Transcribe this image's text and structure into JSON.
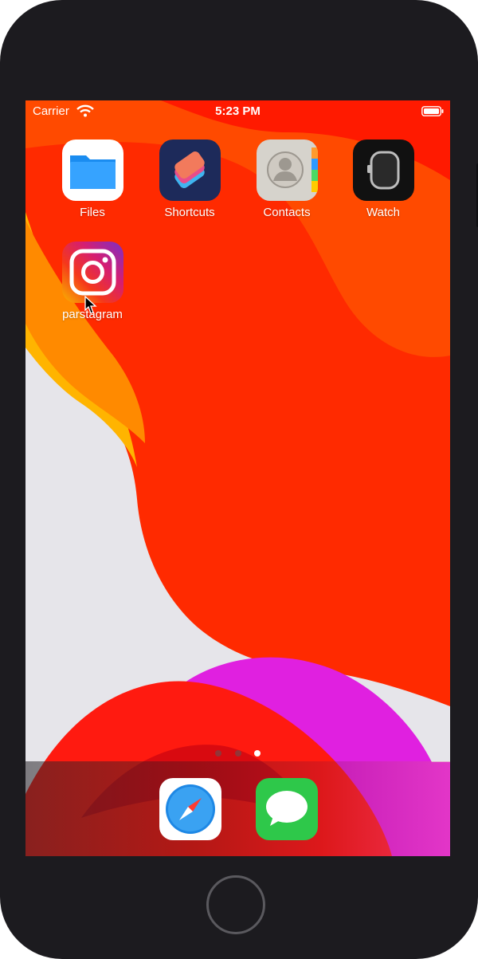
{
  "status_bar": {
    "carrier": "Carrier",
    "time": "5:23 PM"
  },
  "apps": [
    {
      "label": "Files",
      "icon": "files-icon"
    },
    {
      "label": "Shortcuts",
      "icon": "shortcuts-icon"
    },
    {
      "label": "Contacts",
      "icon": "contacts-icon"
    },
    {
      "label": "Watch",
      "icon": "watch-icon"
    },
    {
      "label": "parstagram",
      "icon": "instagram-icon"
    }
  ],
  "page_indicator": {
    "pages": 3,
    "current": 3
  },
  "dock": [
    {
      "icon": "safari-icon"
    },
    {
      "icon": "messages-icon"
    }
  ],
  "colors": {
    "device": "#1c1b1f",
    "wallpaper_red": "#ff2a00",
    "wallpaper_orange": "#ff6a00",
    "wallpaper_magenta": "#e020e0",
    "wallpaper_light": "#e6e5ea"
  }
}
